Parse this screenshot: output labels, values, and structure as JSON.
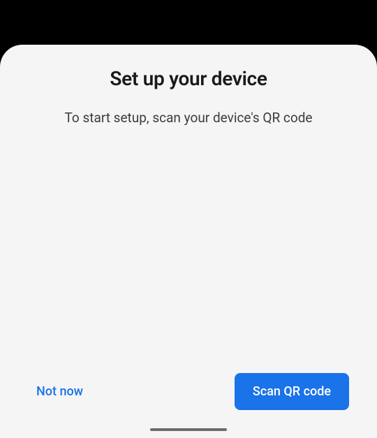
{
  "dialog": {
    "title": "Set up your device",
    "subtitle": "To start setup, scan your device's QR code"
  },
  "actions": {
    "secondary_label": "Not now",
    "primary_label": "Scan QR code"
  }
}
